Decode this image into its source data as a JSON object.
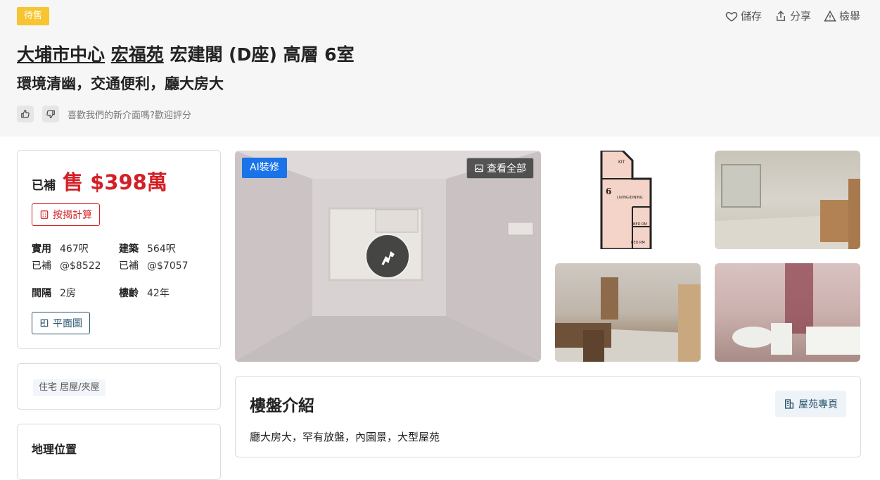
{
  "status_tag": "待售",
  "actions": {
    "save": "儲存",
    "share": "分享",
    "report": "檢舉"
  },
  "title": {
    "district": "大埔市中心",
    "estate": "宏福苑",
    "rest": "宏建閣 (D座) 高層 6室"
  },
  "subtitle": "環境清幽，交通便利，廳大房大",
  "feedback_text": "喜歡我們的新介面嗎?歡迎評分",
  "price": {
    "paid_label": "已補",
    "main": "售 $398萬",
    "calc_label": "按揭計算"
  },
  "specs": {
    "saleable_k": "實用",
    "saleable_v": "467呎",
    "gross_k": "建築",
    "gross_v": "564呎",
    "paid_k1": "已補",
    "paid_v1": "@$8522",
    "paid_k2": "已補",
    "paid_v2": "@$7057",
    "rooms_k": "間隔",
    "rooms_v": "2房",
    "age_k": "樓齡",
    "age_v": "42年"
  },
  "floorplan_label": "平面圖",
  "property_type": "住宅 居屋/夾屋",
  "location_title": "地理位置",
  "photo": {
    "ai_label": "AI裝修",
    "view_all": "查看全部"
  },
  "floorplan_thumb": {
    "kit": "KIT",
    "unit": "6",
    "living": "LIVING/DINING",
    "bed1": "BED RM",
    "bed2": "BED RM"
  },
  "intro": {
    "title": "樓盤介紹",
    "estate_page": "屋苑專頁",
    "text": "廳大房大，罕有放盤，內園景，大型屋苑"
  },
  "colors": {
    "accent_red": "#d32027",
    "tag_yellow": "#f7c531",
    "ai_blue": "#1a73e8",
    "navy": "#2c5570"
  }
}
